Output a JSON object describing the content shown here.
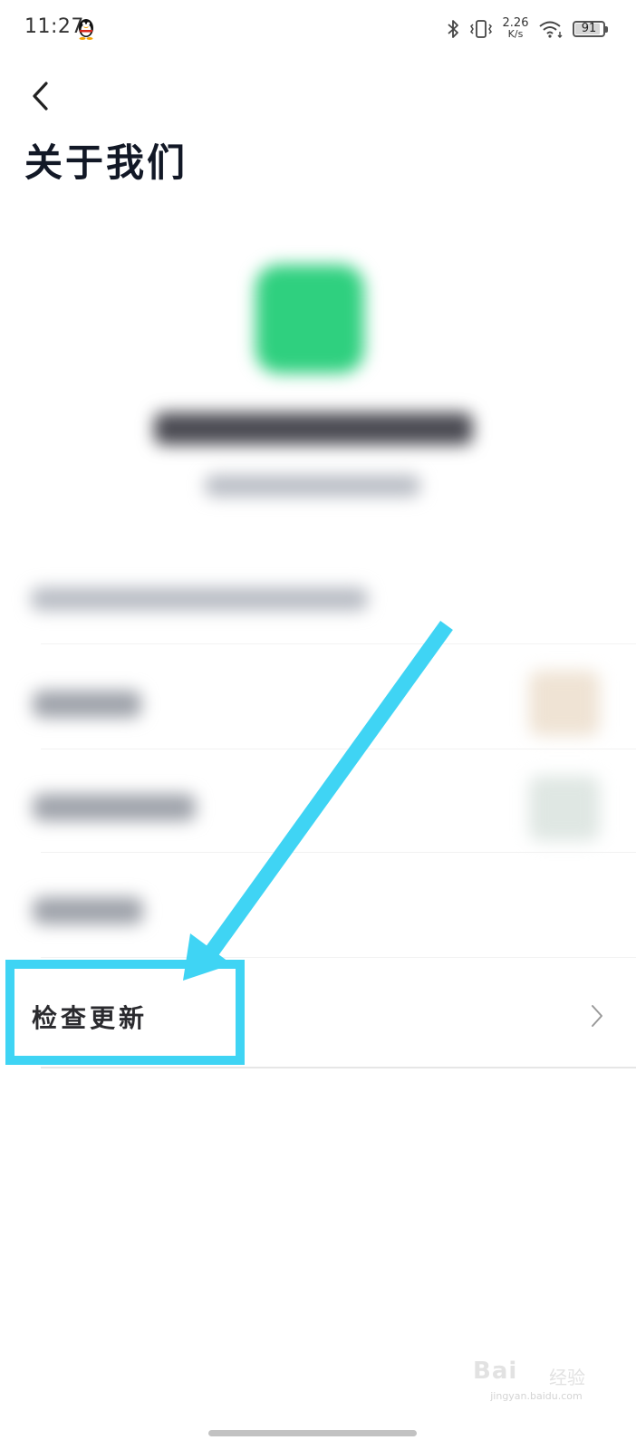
{
  "status_bar": {
    "time": "11:27",
    "net_speed_value": "2.26",
    "net_speed_unit": "K/s",
    "battery": "91",
    "battery_fraction": 0.91
  },
  "header": {
    "title": "关于我们"
  },
  "list": {
    "check_update_label": "检查更新"
  },
  "watermark": {
    "logo": "Bai",
    "logo_cn": "经验",
    "url": "jingyan.baidu.com"
  },
  "colors": {
    "highlight": "#3fd4f4",
    "app_icon": "#2fd07f",
    "title": "#121826"
  },
  "icons": {
    "back": "chevron-left-icon",
    "list_arrow": "chevron-right-icon",
    "qq": "qq-penguin-icon",
    "bluetooth": "bluetooth-icon",
    "vibrate": "vibrate-icon",
    "wifi": "wifi-icon"
  }
}
